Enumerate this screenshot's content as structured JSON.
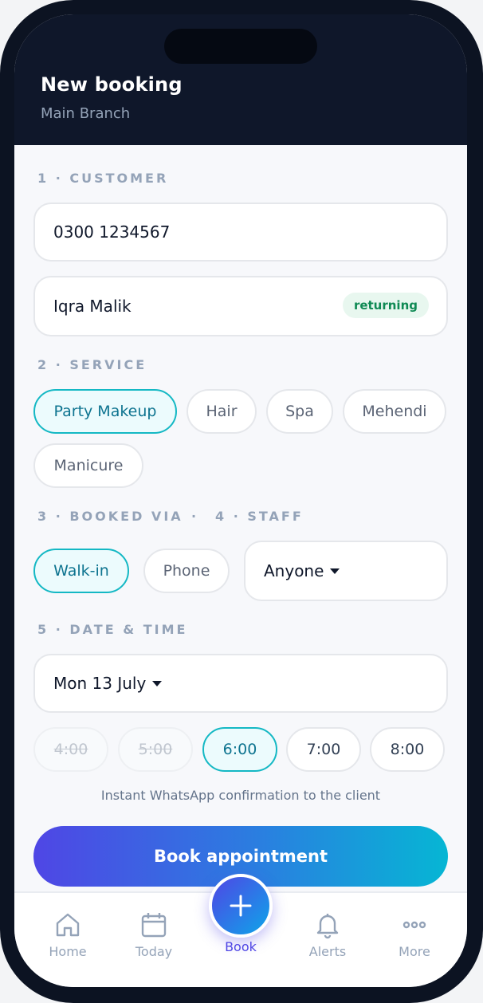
{
  "header": {
    "title": "New booking",
    "subtitle": "Main Branch"
  },
  "customer": {
    "label": "1 · CUSTOMER",
    "phone": "0300 1234567",
    "name": "Iqra Malik",
    "badge": "returning"
  },
  "service": {
    "label": "2 · SERVICE",
    "options": [
      "Party Makeup",
      "Hair",
      "Spa",
      "Mehendi",
      "Manicure"
    ],
    "selected": "Party Makeup"
  },
  "booked_via": {
    "label": "3 · BOOKED VIA",
    "separator": "·",
    "options": [
      "Walk-in",
      "Phone"
    ],
    "selected": "Walk-in"
  },
  "staff": {
    "label": "4 · STAFF",
    "value": "Anyone"
  },
  "datetime": {
    "label": "5 · DATE & TIME",
    "date": "Mon 13 July",
    "slots": [
      {
        "time": "4:00",
        "state": "unavailable"
      },
      {
        "time": "5:00",
        "state": "unavailable"
      },
      {
        "time": "6:00",
        "state": "selected"
      },
      {
        "time": "7:00",
        "state": "available"
      },
      {
        "time": "8:00",
        "state": "available"
      }
    ]
  },
  "hint": "Instant WhatsApp confirmation to the client",
  "book_button": "Book appointment",
  "nav": {
    "items": [
      {
        "label": "Home",
        "icon": "home-icon"
      },
      {
        "label": "Today",
        "icon": "calendar-icon"
      },
      {
        "label": "Book",
        "icon": "plus-icon",
        "active": true
      },
      {
        "label": "Alerts",
        "icon": "bell-icon"
      },
      {
        "label": "More",
        "icon": "more-icon"
      }
    ]
  },
  "colors": {
    "header_bg": "#0f172a",
    "accent_teal": "#14b8c4",
    "accent_indigo": "#4f46e5",
    "gradient_end": "#06b6d4",
    "badge_green": "#0f8a54"
  }
}
